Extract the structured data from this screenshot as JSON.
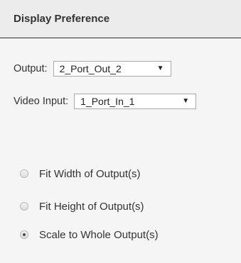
{
  "header": {
    "title": "Display Preference"
  },
  "output": {
    "label": "Output:",
    "selected": "2_Port_Out_2"
  },
  "video_input": {
    "label": "Video Input:",
    "selected": "1_Port_In_1"
  },
  "scaling": {
    "options": [
      {
        "label": "Fit Width of Output(s)",
        "checked": false
      },
      {
        "label": "Fit Height of Output(s)",
        "checked": false
      },
      {
        "label": "Scale to Whole Output(s)",
        "checked": true
      }
    ]
  },
  "icons": {
    "dropdown_arrow": "▼"
  },
  "colors": {
    "background": "#f5f5f5",
    "header_background": "#ececec",
    "text": "#333333"
  }
}
